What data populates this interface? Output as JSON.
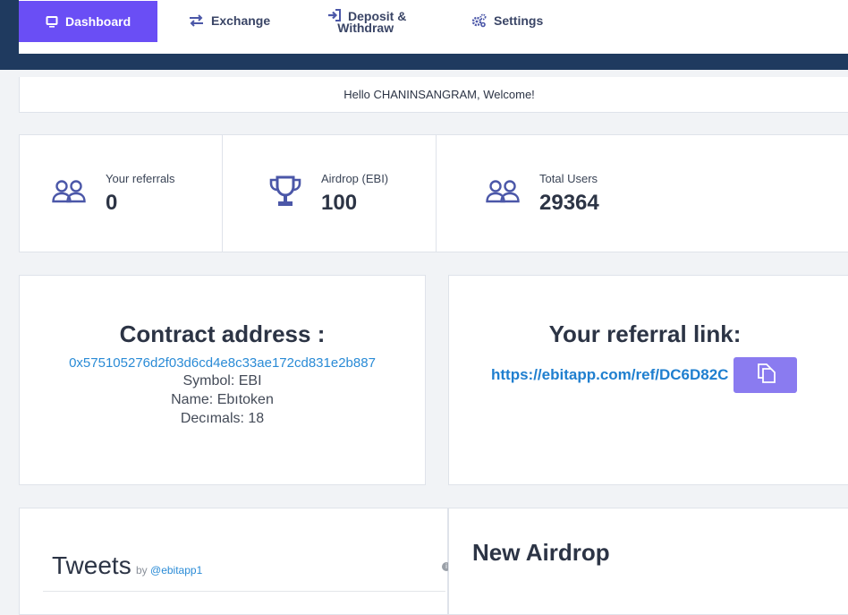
{
  "nav": {
    "items": [
      {
        "label": "Dashboard",
        "icon": "monitor-icon"
      },
      {
        "label": "Exchange",
        "icon": "exchange-arrows-icon"
      },
      {
        "label_line1": "Deposit &",
        "label_line2": "Withdraw",
        "icon": "sign-in-icon"
      },
      {
        "label": "Settings",
        "icon": "gears-icon"
      }
    ],
    "active_color": "#6a4ef5",
    "bar_color": "#1f3a5f"
  },
  "welcome": "Hello CHANINSANGRAM, Welcome!",
  "stats": [
    {
      "label": "Your referrals",
      "value": "0",
      "icon": "users-icon"
    },
    {
      "label": "Airdrop (EBI)",
      "value": "100",
      "icon": "trophy-icon"
    },
    {
      "label": "Total Users",
      "value": "29364",
      "icon": "users-icon"
    }
  ],
  "contract": {
    "heading": "Contract address :",
    "address": "0x575105276d2f03d6cd4e8c33ae172cd831e2b887",
    "symbol": "Symbol: EBI",
    "name": "Name: Ebıtoken",
    "decimals": "Decımals: 18"
  },
  "referral": {
    "heading": "Your referral link:",
    "link": "https://ebitapp.com/ref/DC6D82C",
    "copy_icon": "copy-icon"
  },
  "tweets": {
    "heading": "Tweets",
    "by": "by",
    "handle": "@ebitapp1"
  },
  "airdrop": {
    "heading": "New Airdrop"
  }
}
